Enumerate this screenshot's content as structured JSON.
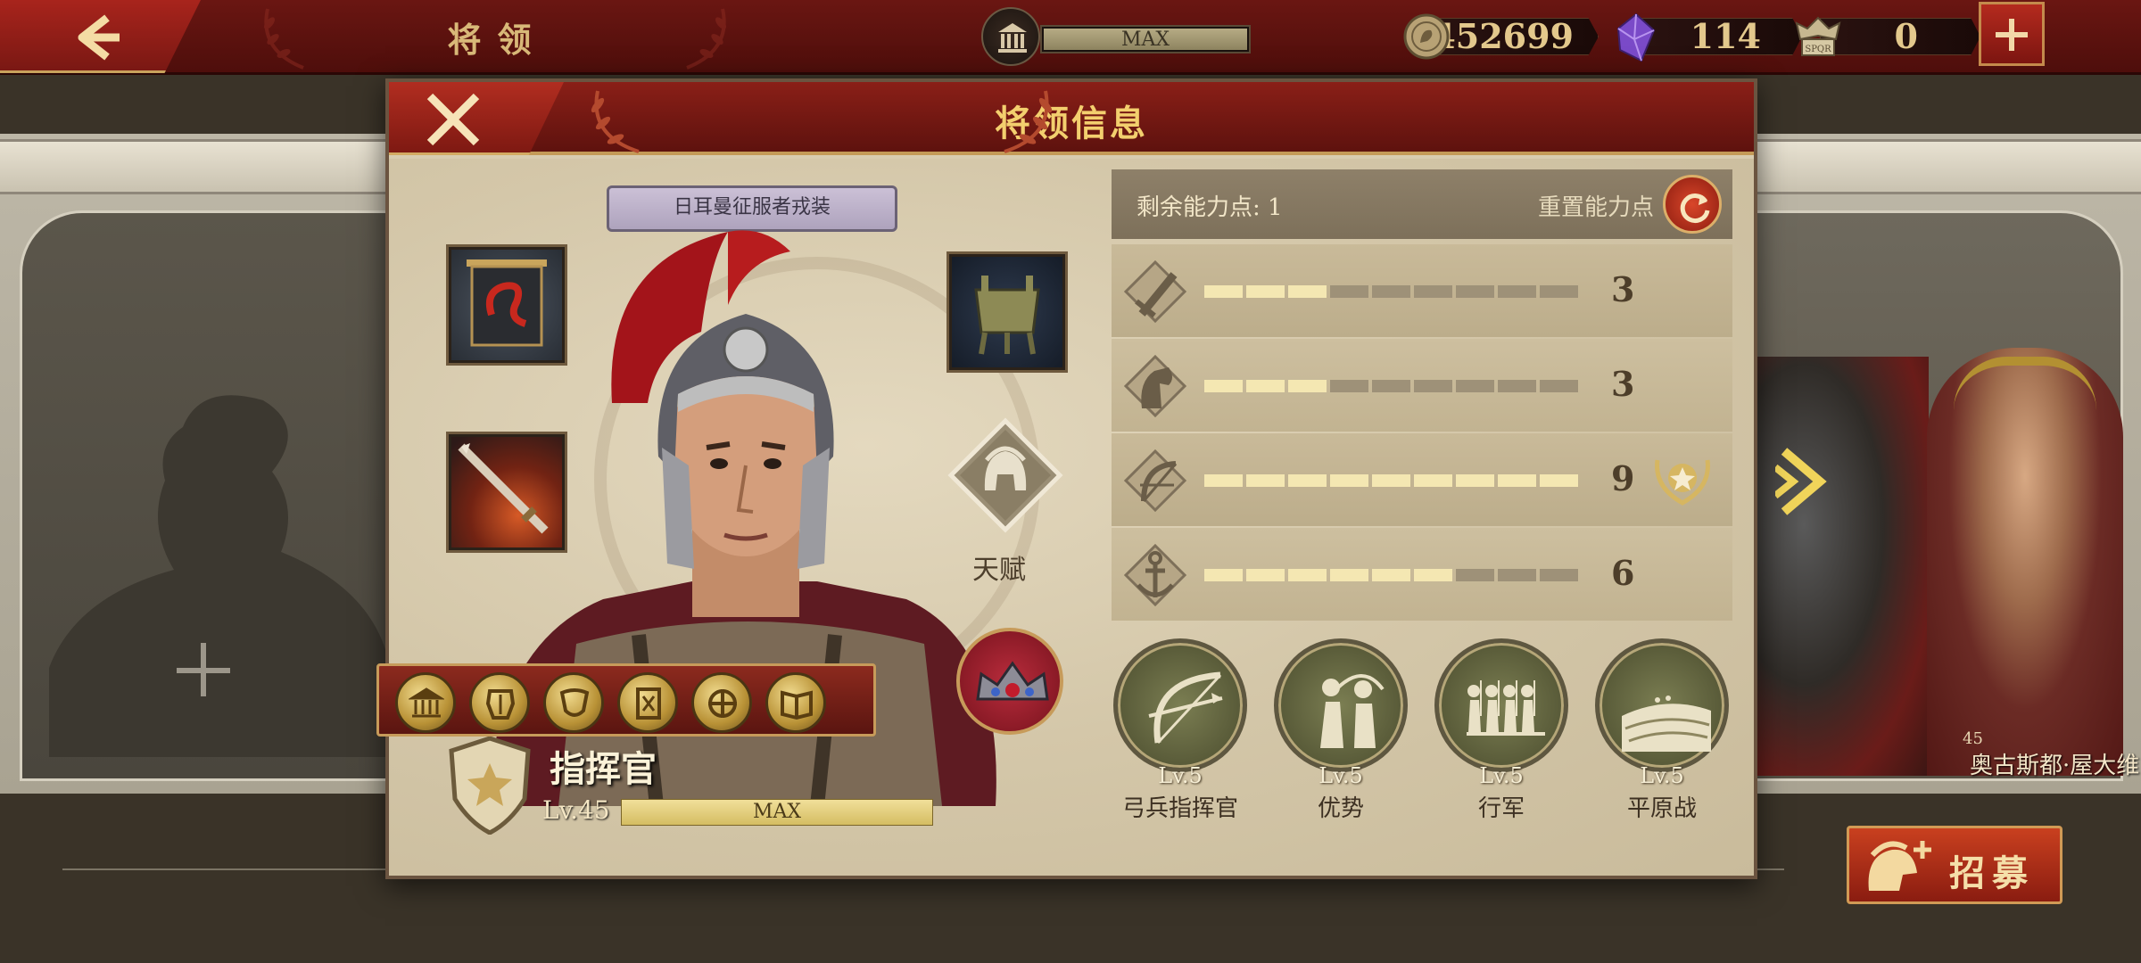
{
  "topbar": {
    "title": "将领",
    "bank_level": "MAX",
    "coins": "452699",
    "gems": "114",
    "spqr_tokens": "0",
    "spqr_text": "SPQR"
  },
  "background": {
    "hero_right_name": "奥古斯都·屋大维",
    "hero_right_level": "45",
    "hero_mid_name": "",
    "recruit_label": "招募"
  },
  "dialog": {
    "title": "将领信息",
    "skin_name": "日耳曼征服者戎装",
    "talent_label": "天赋",
    "rank_title": "指挥官",
    "level": "Lv.45",
    "exp_label": "MAX",
    "exp_fraction": 1.0,
    "stats": {
      "points_label": "剩余能力点: 1",
      "reset_label": "重置能力点",
      "max_segments": 9,
      "rows": [
        {
          "icon": "sword-icon",
          "value": 3
        },
        {
          "icon": "cavalry-icon",
          "value": 3
        },
        {
          "icon": "bow-icon",
          "value": 9,
          "mastered": true
        },
        {
          "icon": "anchor-icon",
          "value": 6
        }
      ]
    },
    "skills": [
      {
        "icon": "archer-commander-icon",
        "level": "Lv.5",
        "name": "弓兵指挥官"
      },
      {
        "icon": "advantage-icon",
        "level": "Lv.5",
        "name": "优势"
      },
      {
        "icon": "march-icon",
        "level": "Lv.5",
        "name": "行军"
      },
      {
        "icon": "plains-battle-icon",
        "level": "Lv.5",
        "name": "平原战"
      }
    ]
  },
  "colors": {
    "accent_red": "#8a1f17",
    "gold": "#f3cf6e",
    "panel": "#d8ccb0"
  }
}
